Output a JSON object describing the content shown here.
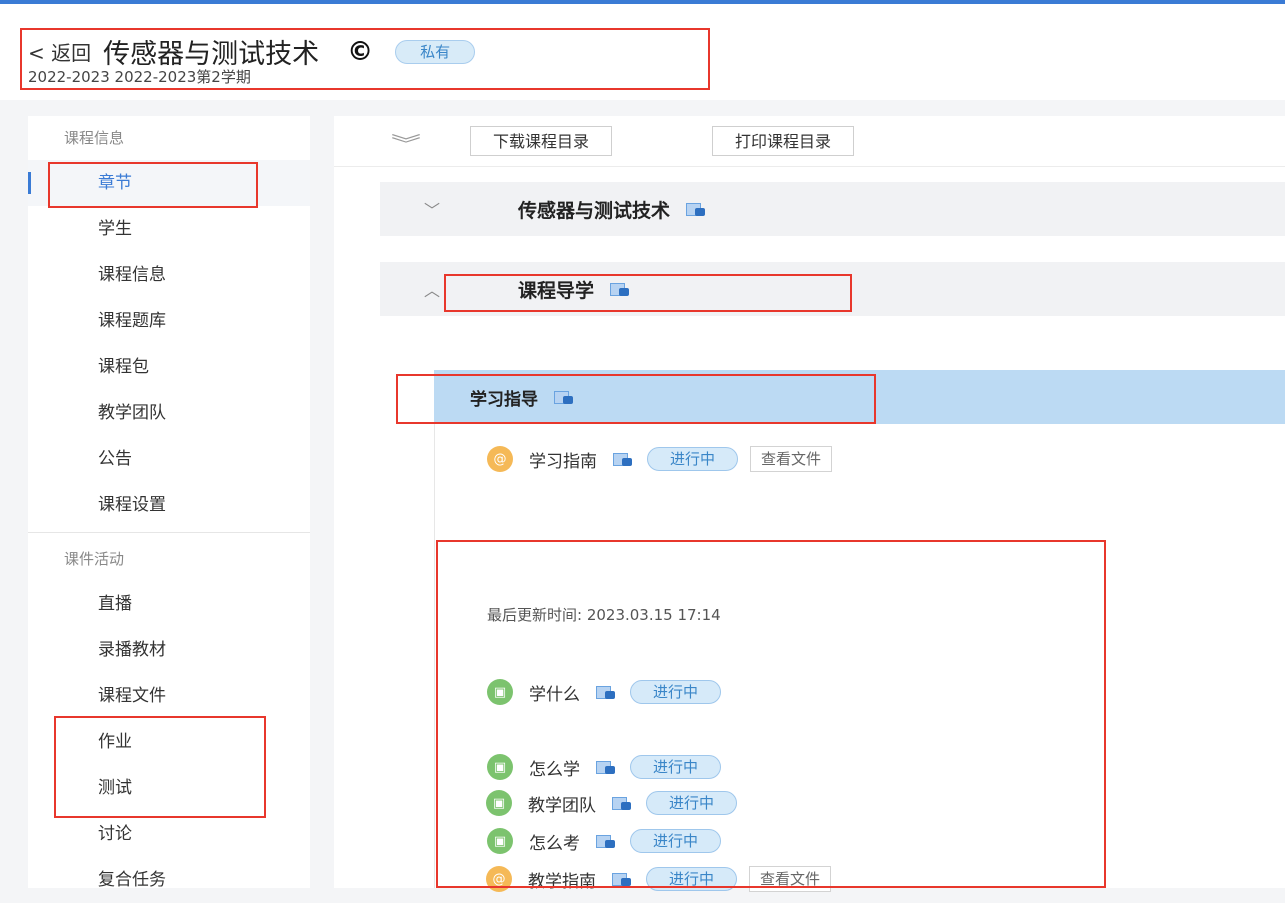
{
  "header": {
    "back_label": "< 返回",
    "course_title": "传感器与测试技术",
    "copyright_symbol": "©",
    "visibility_badge": "私有",
    "semester": "2022-2023 2022-2023第2学期"
  },
  "sidebar": {
    "groups": [
      {
        "title": "课程信息",
        "items": [
          "章节",
          "学生",
          "课程信息",
          "课程题库",
          "课程包",
          "教学团队",
          "公告",
          "课程设置"
        ]
      },
      {
        "title": "课件活动",
        "items": [
          "直播",
          "录播教材",
          "课程文件",
          "作业",
          "测试",
          "讨论",
          "复合任务"
        ]
      }
    ],
    "active_item": "章节"
  },
  "toolbar": {
    "collapse_icon": "double-chevron-down-icon",
    "download_label": "下载课程目录",
    "print_label": "打印课程目录"
  },
  "sections": [
    {
      "title": "传感器与测试技术",
      "expanded": false
    },
    {
      "title": "课程导学",
      "expanded": true
    }
  ],
  "chapter": {
    "title": "学习指导"
  },
  "tasks": [
    {
      "name": "学习指南",
      "icon": "link-icon",
      "status": "进行中",
      "action": "查看文件",
      "updated_label": "最后更新时间: 2023.03.15 17:14"
    },
    {
      "name": "学什么",
      "icon": "document-icon",
      "status": "进行中"
    },
    {
      "name": "怎么学",
      "icon": "document-icon",
      "status": "进行中"
    },
    {
      "name": "怎么考",
      "icon": "document-icon",
      "status": "进行中"
    },
    {
      "name": "教学团队",
      "icon": "document-icon",
      "status": "进行中"
    },
    {
      "name": "教学指南",
      "icon": "link-icon",
      "status": "进行中",
      "action": "查看文件"
    }
  ],
  "colors": {
    "accent": "#3a7bd5",
    "highlight_box": "#e8372c",
    "status_badge_bg": "#d6eaf9",
    "chapter_bg": "#bcdaf3"
  }
}
